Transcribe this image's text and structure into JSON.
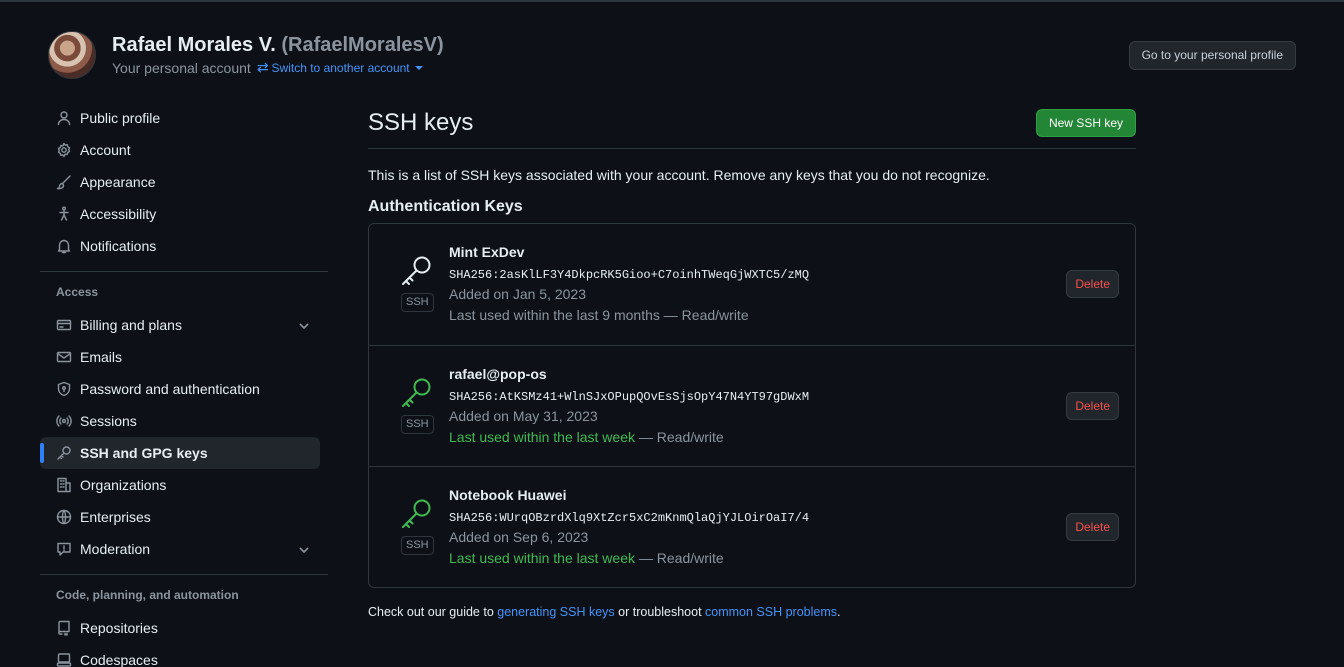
{
  "header": {
    "name": "Rafael Morales V.",
    "login": "(RafaelMoralesV)",
    "subtitle": "Your personal account",
    "switch_label": "Switch to another account",
    "profile_button": "Go to your personal profile"
  },
  "sidebar": {
    "items_top": [
      {
        "label": "Public profile",
        "icon": "person-icon"
      },
      {
        "label": "Account",
        "icon": "gear-icon"
      },
      {
        "label": "Appearance",
        "icon": "paintbrush-icon"
      },
      {
        "label": "Accessibility",
        "icon": "accessibility-icon"
      },
      {
        "label": "Notifications",
        "icon": "bell-icon"
      }
    ],
    "access_title": "Access",
    "items_access": [
      {
        "label": "Billing and plans",
        "icon": "credit-card-icon"
      },
      {
        "label": "Emails",
        "icon": "mail-icon"
      },
      {
        "label": "Password and authentication",
        "icon": "shield-lock-icon"
      },
      {
        "label": "Sessions",
        "icon": "broadcast-icon"
      },
      {
        "label": "SSH and GPG keys",
        "icon": "key-icon"
      },
      {
        "label": "Organizations",
        "icon": "organization-icon"
      },
      {
        "label": "Enterprises",
        "icon": "globe-icon"
      },
      {
        "label": "Moderation",
        "icon": "report-icon"
      }
    ],
    "code_title": "Code, planning, and automation",
    "items_code": [
      {
        "label": "Repositories",
        "icon": "repo-icon"
      },
      {
        "label": "Codespaces",
        "icon": "codespaces-icon"
      }
    ]
  },
  "main": {
    "title": "SSH keys",
    "new_button": "New SSH key",
    "intro": "This is a list of SSH keys associated with your account. Remove any keys that you do not recognize.",
    "auth_heading": "Authentication Keys",
    "keys": [
      {
        "name": "Mint ExDev",
        "fingerprint": "SHA256:2asKlLF3Y4DkpcRK5Gioo+C7oinhTWeqGjWXTC5/zMQ",
        "added": "Added on Jan 5, 2023",
        "last_used": "Last used within the last 9 months",
        "access": " — Read/write",
        "badge": "SSH",
        "delete": "Delete",
        "icon_color": "#e6edf3"
      },
      {
        "name": "rafael@pop-os",
        "fingerprint": "SHA256:AtKSMz41+WlnSJxOPupQOvEsSjsOpY47N4YT97gDWxM",
        "added": "Added on May 31, 2023",
        "last_used": "Last used within the last week",
        "access": " — Read/write",
        "badge": "SSH",
        "delete": "Delete",
        "icon_color": "#3fb950"
      },
      {
        "name": "Notebook Huawei",
        "fingerprint": "SHA256:WUrqOBzrdXlq9XtZcr5xC2mKnmQlaQjYJLOirOaI7/4",
        "added": "Added on Sep 6, 2023",
        "last_used": "Last used within the last week",
        "access": " — Read/write",
        "badge": "SSH",
        "delete": "Delete",
        "icon_color": "#3fb950"
      }
    ],
    "footer": {
      "pre": "Check out our guide to ",
      "link1": "generating SSH keys",
      "mid": " or troubleshoot ",
      "link2": "common SSH problems",
      "post": "."
    }
  },
  "colors": {
    "background": "#0d1117",
    "accent": "#2f81f7",
    "primary_button": "#238636",
    "danger": "#f85149",
    "success": "#3fb950"
  }
}
